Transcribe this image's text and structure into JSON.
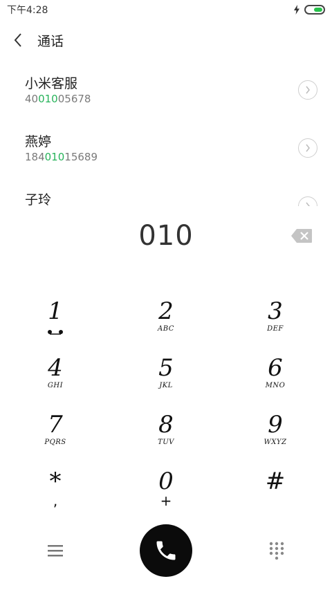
{
  "status_bar": {
    "time": "下午4:28",
    "battery_color": "#27c24c"
  },
  "header": {
    "title": "通话",
    "back_icon": "chevron-left-icon"
  },
  "contacts": [
    {
      "name": "小米客服",
      "number_pre": "40",
      "number_match": "010",
      "number_post": "05678"
    },
    {
      "name": "燕婷",
      "number_pre": "184",
      "number_match": "010",
      "number_post": "15689"
    },
    {
      "name": "子玲",
      "number_pre": "",
      "number_match": "",
      "number_post": ""
    }
  ],
  "dialer": {
    "input": "010",
    "backspace_icon": "backspace-icon",
    "keys": [
      {
        "digit": "1",
        "letters": "",
        "sub": "voicemail"
      },
      {
        "digit": "2",
        "letters": "ABC",
        "sub": ""
      },
      {
        "digit": "3",
        "letters": "DEF",
        "sub": ""
      },
      {
        "digit": "4",
        "letters": "GHI",
        "sub": ""
      },
      {
        "digit": "5",
        "letters": "JKL",
        "sub": ""
      },
      {
        "digit": "6",
        "letters": "MNO",
        "sub": ""
      },
      {
        "digit": "7",
        "letters": "PQRS",
        "sub": ""
      },
      {
        "digit": "8",
        "letters": "TUV",
        "sub": ""
      },
      {
        "digit": "9",
        "letters": "WXYZ",
        "sub": ""
      },
      {
        "digit": "*",
        "letters": "",
        "sub": ","
      },
      {
        "digit": "0",
        "letters": "",
        "sub": "+"
      },
      {
        "digit": "#",
        "letters": "",
        "sub": ""
      }
    ]
  },
  "bottom_bar": {
    "menu_icon": "menu-icon",
    "call_icon": "phone-icon",
    "dialpad_icon": "dialpad-icon",
    "call_button_color": "#0b0b0b"
  },
  "colors": {
    "match_highlight": "#27b35a",
    "secondary_text": "#7a7a7a"
  }
}
